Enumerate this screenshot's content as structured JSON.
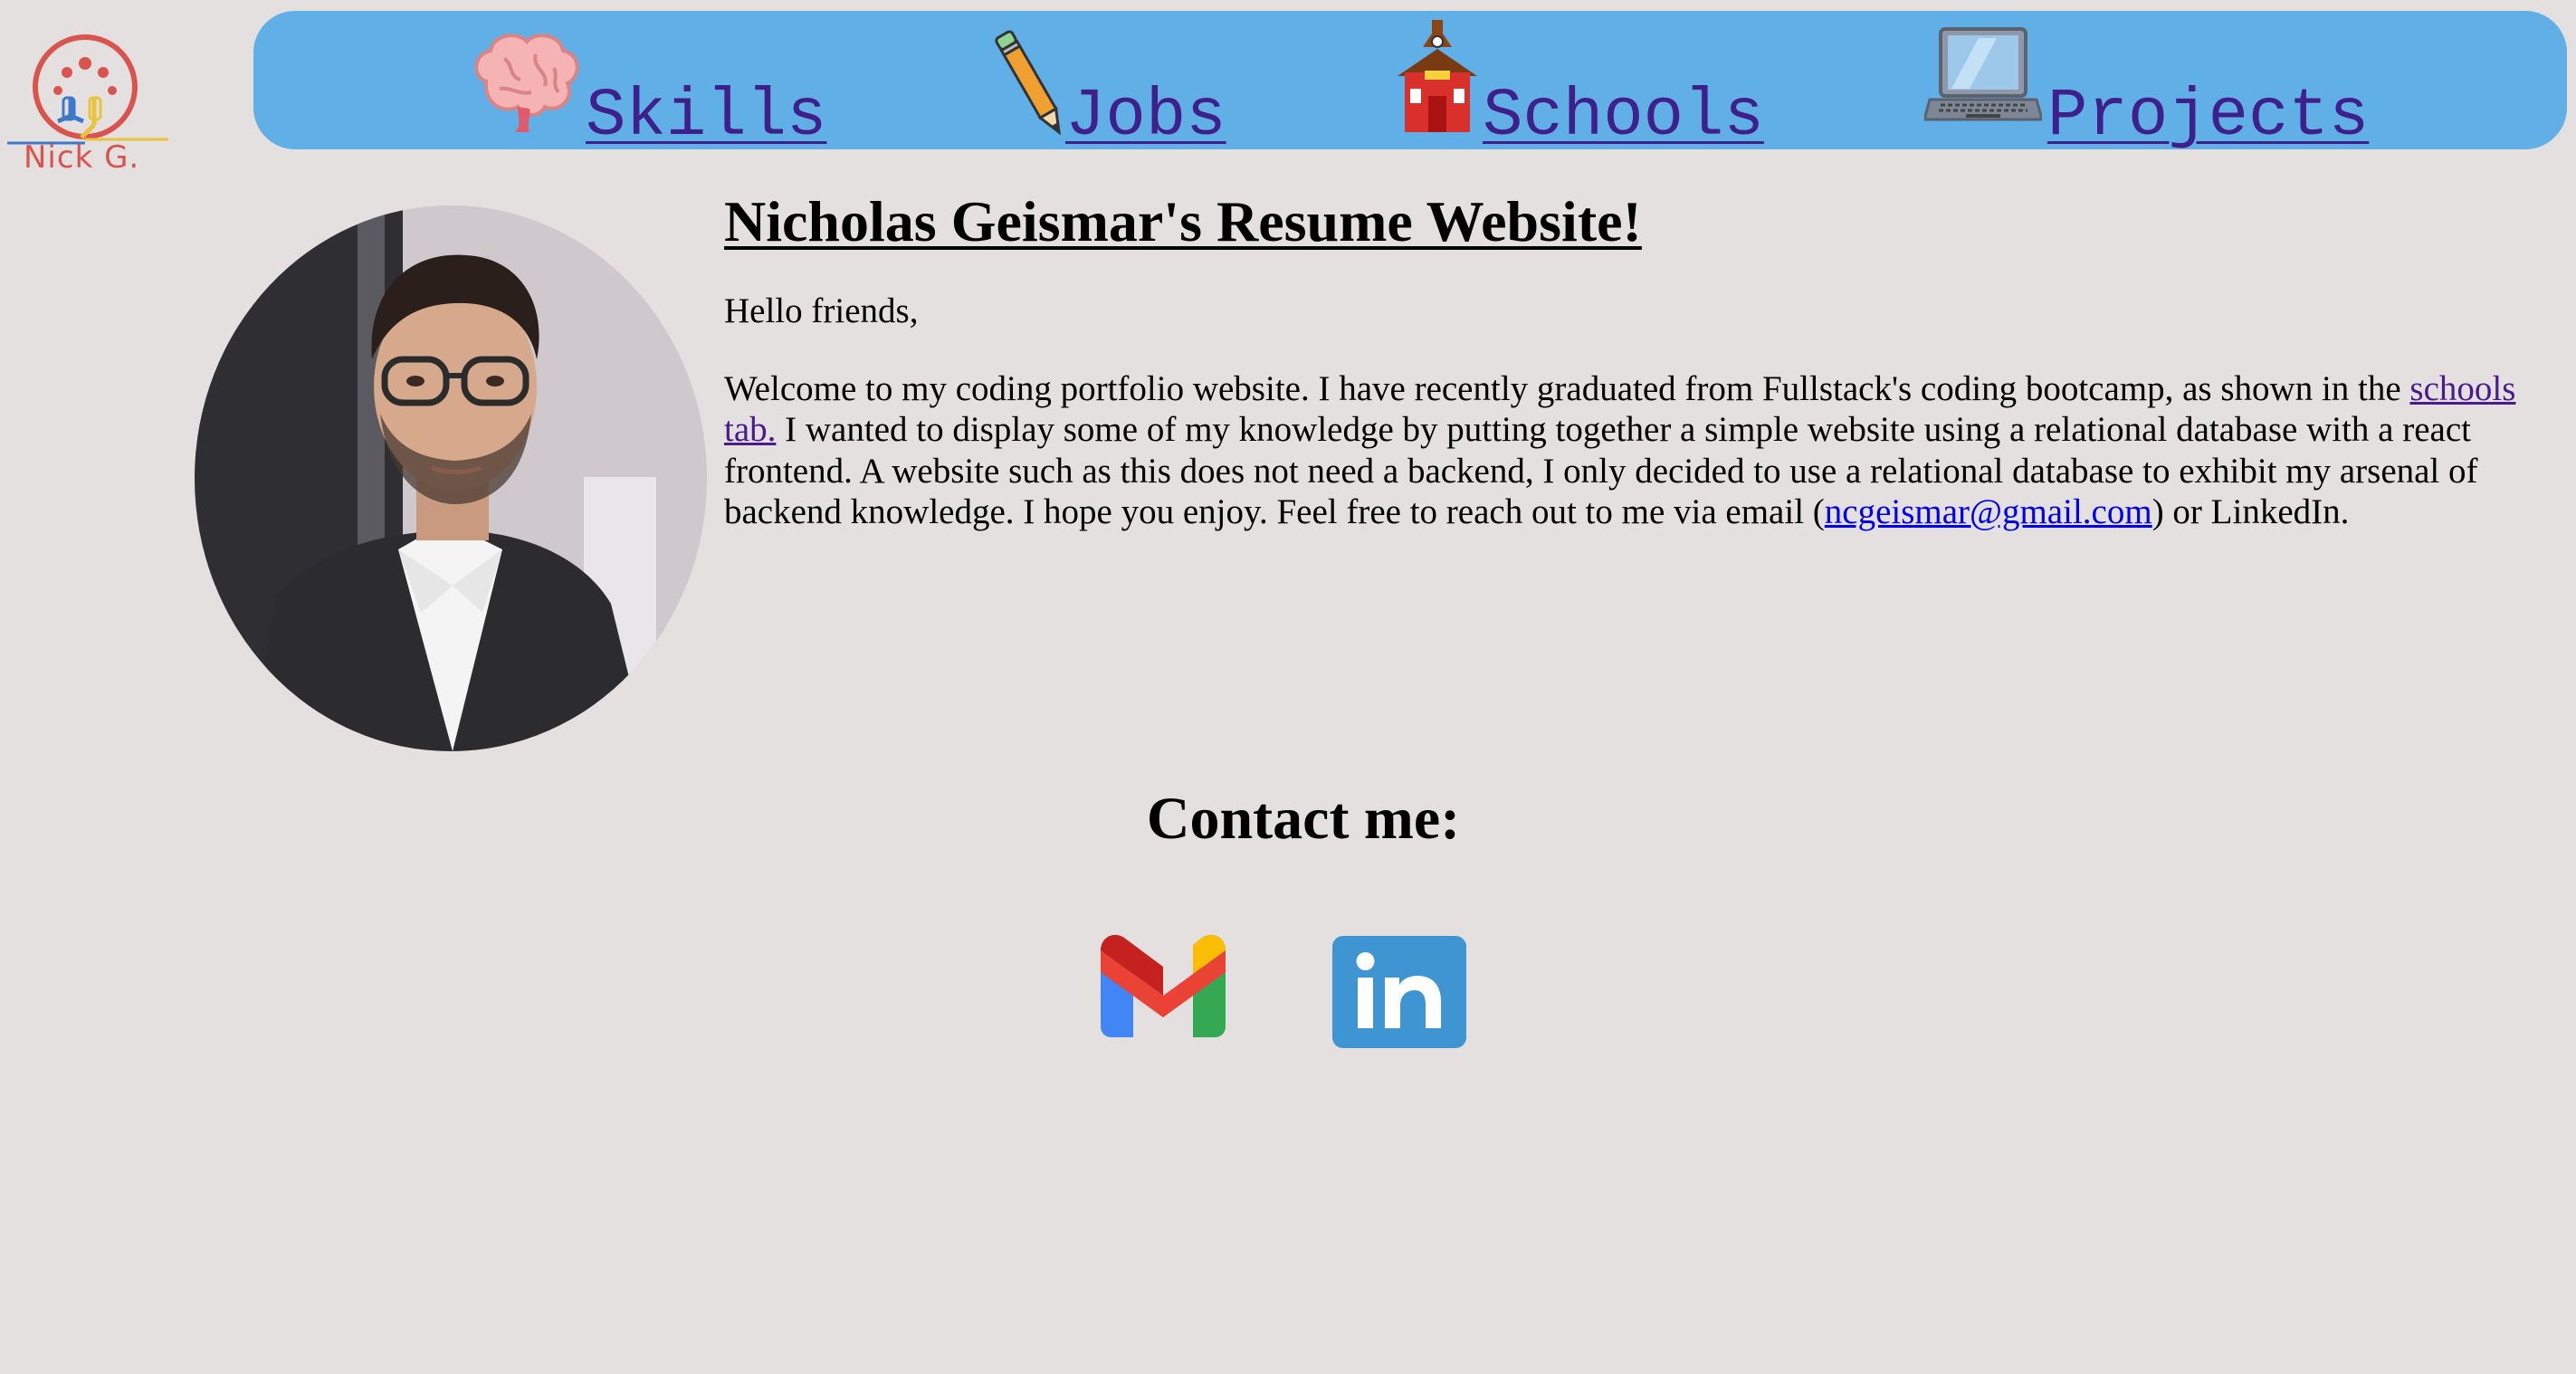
{
  "logo": {
    "text": "Nick G.",
    "icon": "neuron-logo-icon"
  },
  "nav": {
    "items": [
      {
        "label": "Skills",
        "icon": "brain-icon"
      },
      {
        "label": "Jobs",
        "icon": "pencil-icon"
      },
      {
        "label": "Schools",
        "icon": "schoolhouse-icon"
      },
      {
        "label": "Projects",
        "icon": "laptop-icon"
      }
    ]
  },
  "profile": {
    "photo_icon": "profile-photo"
  },
  "intro": {
    "title": "Nicholas Geismar's Resume Website!",
    "greeting": "Hello friends,",
    "text_before_link": "Welcome to my coding portfolio website. I have recently graduated from Fullstack's coding bootcamp, as shown in the ",
    "schools_link": "schools tab.",
    "text_after_link": " I wanted to display some of my knowledge by putting together a simple website using a relational database with a react frontend. A website such as this does not need a backend, I only decided to use a relational database to exhibit my arsenal of backend knowledge. I hope you enjoy. Feel free to reach out to me via email (",
    "email": "ncgeismar@gmail.com",
    "text_end": ") or LinkedIn."
  },
  "contact": {
    "heading": "Contact me:",
    "gmail_icon": "gmail-icon",
    "linkedin_icon": "linkedin-icon"
  },
  "colors": {
    "background": "#e3e0df",
    "navbar": "#61afe7",
    "nav_link": "#3f1f8a",
    "visited_link": "#4a1b8f",
    "email_link": "#0000ee",
    "logo_red": "#d9534f",
    "linkedin_blue": "#3e95d1"
  }
}
